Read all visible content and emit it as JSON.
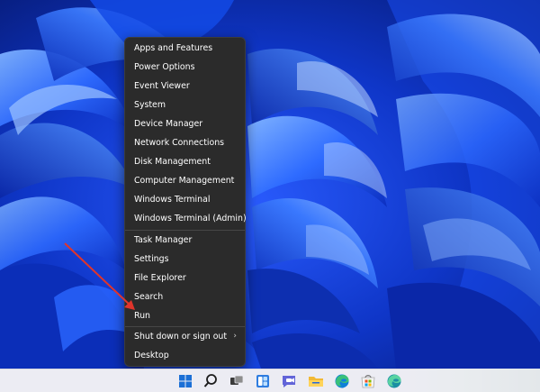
{
  "colors": {
    "desktop_bg": "#0a2a9c",
    "menu_bg": "#2b2b2b",
    "menu_text": "#ffffff",
    "arrow": "#e0352b",
    "taskbar_bg": "#ececf3"
  },
  "winx_menu": {
    "group1": [
      "Apps and Features",
      "Power Options",
      "Event Viewer",
      "System",
      "Device Manager",
      "Network Connections",
      "Disk Management",
      "Computer Management",
      "Windows Terminal",
      "Windows Terminal (Admin)"
    ],
    "group2": [
      "Task Manager",
      "Settings",
      "File Explorer",
      "Search",
      "Run"
    ],
    "group3": [
      "Shut down or sign out",
      "Desktop"
    ]
  },
  "taskbar": {
    "icons": [
      "start-icon",
      "search-icon",
      "task-view-icon",
      "widgets-icon",
      "teams-chat-icon",
      "file-explorer-icon",
      "edge-icon",
      "store-icon",
      "edge-dev-icon"
    ]
  }
}
